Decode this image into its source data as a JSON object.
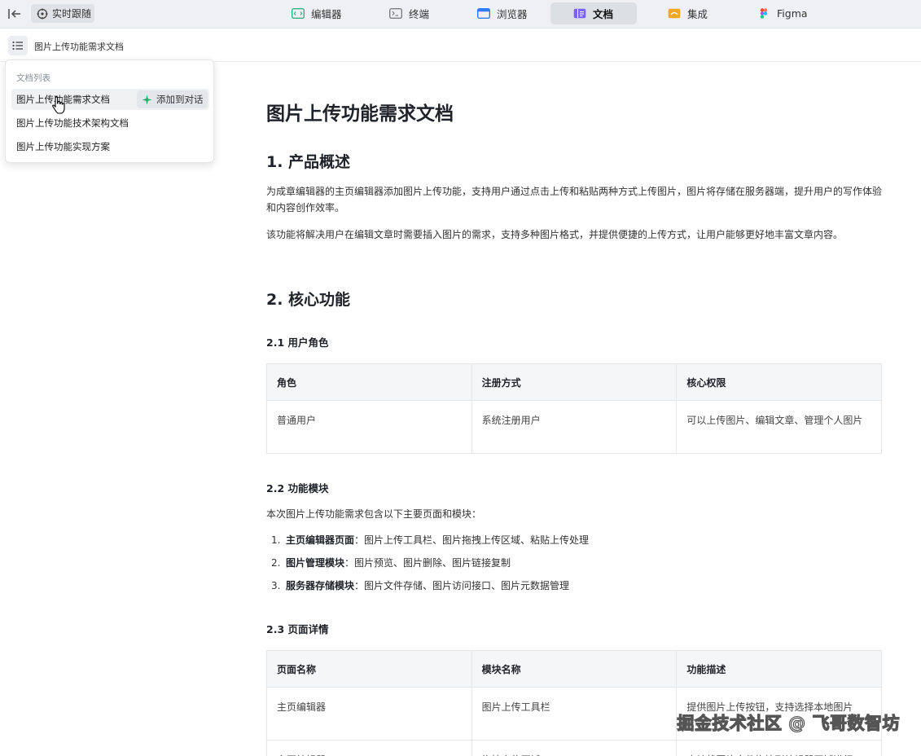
{
  "topbar": {
    "follow_label": "实时跟随",
    "tabs": [
      {
        "label": "编辑器",
        "icon": "code-editor-icon",
        "color": "#2fb380"
      },
      {
        "label": "终端",
        "icon": "terminal-icon",
        "color": "#7a7f87"
      },
      {
        "label": "浏览器",
        "icon": "browser-icon",
        "color": "#2f7df6"
      },
      {
        "label": "文档",
        "icon": "document-icon",
        "color": "#7b61ff"
      },
      {
        "label": "集成",
        "icon": "integration-icon",
        "color": "#f5a623"
      },
      {
        "label": "Figma",
        "icon": "figma-icon",
        "color": "#f24e1e"
      }
    ],
    "active_tab": "文档"
  },
  "docbar": {
    "current_doc": "图片上传功能需求文档"
  },
  "dropdown": {
    "title": "文档列表",
    "items": [
      {
        "label": "图片上传功能需求文档"
      },
      {
        "label": "图片上传功能技术架构文档"
      },
      {
        "label": "图片上传功能实现方案"
      }
    ],
    "add_to_chat": "添加到对话"
  },
  "doc": {
    "title": "图片上传功能需求文档",
    "section1": {
      "heading": "1. 产品概述",
      "p1": "为成章编辑器的主页编辑器添加图片上传功能，支持用户通过点击上传和粘贴两种方式上传图片，图片将存储在服务器端，提升用户的写作体验和内容创作效率。",
      "p2": "该功能将解决用户在编辑文章时需要插入图片的需求，支持多种图片格式，并提供便捷的上传方式，让用户能够更好地丰富文章内容。"
    },
    "section2": {
      "heading": "2. 核心功能",
      "roles": {
        "heading": "2.1 用户角色",
        "headers": [
          "角色",
          "注册方式",
          "核心权限"
        ],
        "rows": [
          [
            "普通用户",
            "系统注册用户",
            "可以上传图片、编辑文章、管理个人图片"
          ]
        ]
      },
      "modules": {
        "heading": "2.2 功能模块",
        "intro": "本次图片上传功能需求包含以下主要页面和模块：",
        "items": [
          {
            "num": "1.",
            "name": "主页编辑器页面",
            "desc": "：图片上传工具栏、图片拖拽上传区域、粘贴上传处理"
          },
          {
            "num": "2.",
            "name": "图片管理模块",
            "desc": "：图片预览、图片删除、图片链接复制"
          },
          {
            "num": "3.",
            "name": "服务器存储模块",
            "desc": "：图片文件存储、图片访问接口、图片元数据管理"
          }
        ]
      },
      "pages": {
        "heading": "2.3 页面详情",
        "headers": [
          "页面名称",
          "模块名称",
          "功能描述"
        ],
        "rows": [
          [
            "主页编辑器",
            "图片上传工具栏",
            "提供图片上传按钮，支持选择本地图片"
          ],
          [
            "主页编辑器",
            "拖拽上传区域",
            "支持将图片文件拖拽到编辑器区域进行"
          ]
        ]
      }
    }
  },
  "watermark": "掘金技术社区 @ 飞哥数智坊"
}
